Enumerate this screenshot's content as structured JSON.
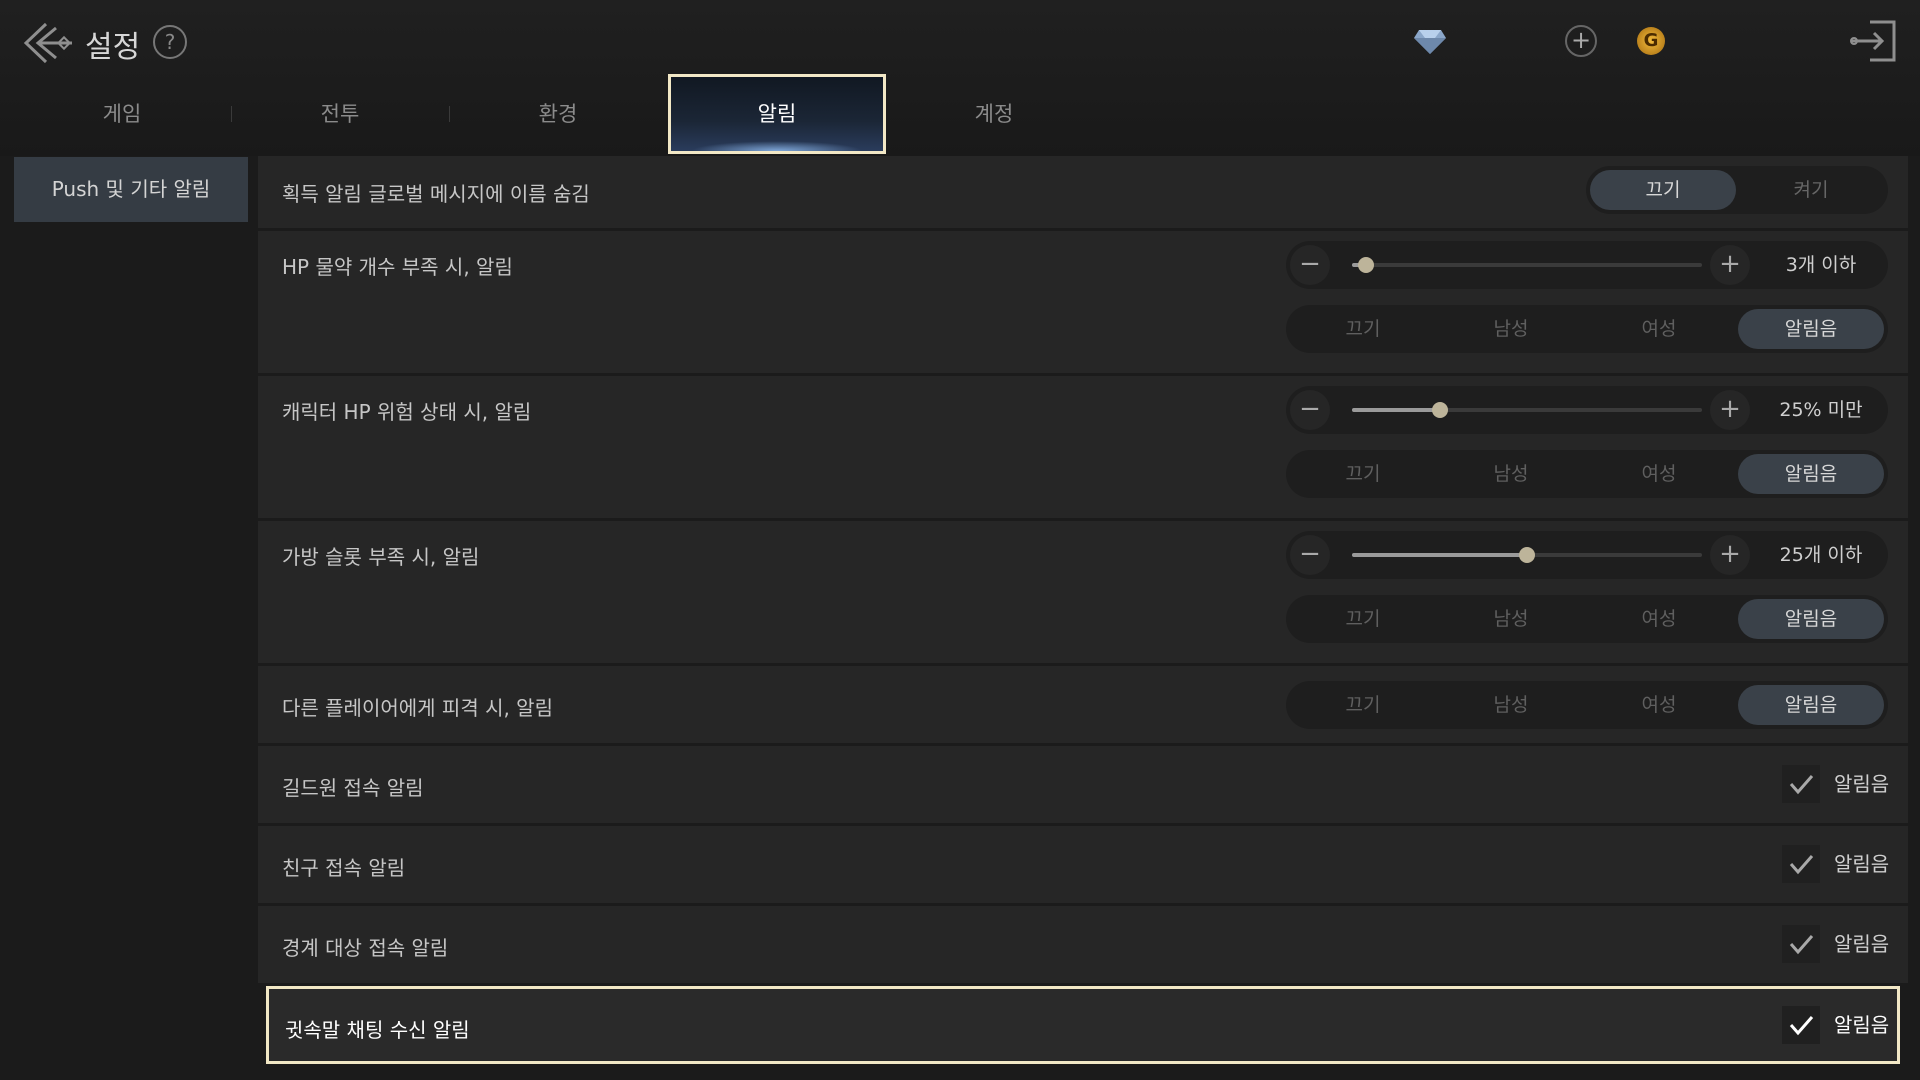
{
  "header": {
    "title": "설정",
    "help_glyph": "?",
    "plus_glyph": "+",
    "coin_glyph": "G"
  },
  "tabs": [
    {
      "label": "게임",
      "active": false
    },
    {
      "label": "전투",
      "active": false
    },
    {
      "label": "환경",
      "active": false
    },
    {
      "label": "알림",
      "active": true
    },
    {
      "label": "계정",
      "active": false
    }
  ],
  "sidebar": {
    "items": [
      {
        "label": "Push 및 기타 알림",
        "active": true
      }
    ]
  },
  "settings": {
    "global_hide_name": {
      "label": "획득 알림 글로벌 메시지에 이름 숨김",
      "options": [
        "끄기",
        "켜기"
      ],
      "selected": "끄기"
    },
    "hp_potion": {
      "label": "HP 물약 개수 부족 시, 알림",
      "minus": "−",
      "plus": "+",
      "slider_fraction": 0.04,
      "slider_value": "3개 이하",
      "sound_options": [
        "끄기",
        "남성",
        "여성",
        "알림음"
      ],
      "sound_selected": "알림음"
    },
    "char_hp": {
      "label": "캐릭터 HP 위험 상태 시, 알림",
      "minus": "−",
      "plus": "+",
      "slider_fraction": 0.25,
      "slider_value": "25% 미만",
      "sound_options": [
        "끄기",
        "남성",
        "여성",
        "알림음"
      ],
      "sound_selected": "알림음"
    },
    "bag_slot": {
      "label": "가방 슬롯 부족 시, 알림",
      "minus": "−",
      "plus": "+",
      "slider_fraction": 0.5,
      "slider_value": "25개 이하",
      "sound_options": [
        "끄기",
        "남성",
        "여성",
        "알림음"
      ],
      "sound_selected": "알림음"
    },
    "pvp_hit": {
      "label": "다른 플레이어에게 피격 시, 알림",
      "sound_options": [
        "끄기",
        "남성",
        "여성",
        "알림음"
      ],
      "sound_selected": "알림음"
    },
    "guild_login": {
      "label": "길드원 접속 알림",
      "check_label": "알림음",
      "checked": true
    },
    "friend_login": {
      "label": "친구 접속 알림",
      "check_label": "알림음",
      "checked": true
    },
    "watch_login": {
      "label": "경계 대상 접속 알림",
      "check_label": "알림음",
      "checked": true
    },
    "whisper": {
      "label": "귓속말 채팅 수신 알림",
      "check_label": "알림음",
      "checked": true
    }
  },
  "colors": {
    "highlight_border": "#f2e8c6",
    "active_segment": "#3a4149",
    "slider_knob": "#bdb49a"
  }
}
